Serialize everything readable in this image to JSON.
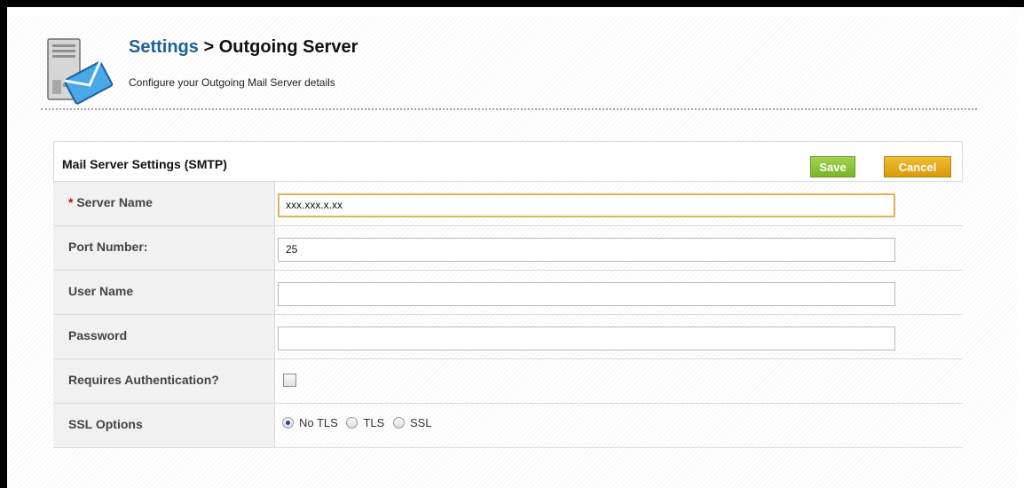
{
  "header": {
    "icon": "mail-server-icon",
    "breadcrumb_link": "Settings",
    "breadcrumb_sep": " > ",
    "title": "Outgoing Server",
    "subtitle": "Configure your Outgoing Mail Server details"
  },
  "panel": {
    "title": "Mail Server Settings (SMTP)",
    "save_label": "Save",
    "cancel_label": "Cancel",
    "colors": {
      "save": "#7ab52a",
      "cancel": "#e3a51c",
      "link": "#1f5f9a",
      "required": "#dd0000"
    }
  },
  "form": {
    "server_name": {
      "required_mark": "* ",
      "label": "Server Name",
      "value": "xxx.xxx.x.xx"
    },
    "port": {
      "label": "Port Number:",
      "value": "25"
    },
    "username": {
      "label": "User Name",
      "value": ""
    },
    "password": {
      "label": "Password",
      "value": ""
    },
    "auth": {
      "label": "Requires Authentication?",
      "checked": false
    },
    "ssl": {
      "label": "SSL Options",
      "selected": "No TLS",
      "options": [
        "No TLS",
        "TLS",
        "SSL"
      ]
    }
  }
}
